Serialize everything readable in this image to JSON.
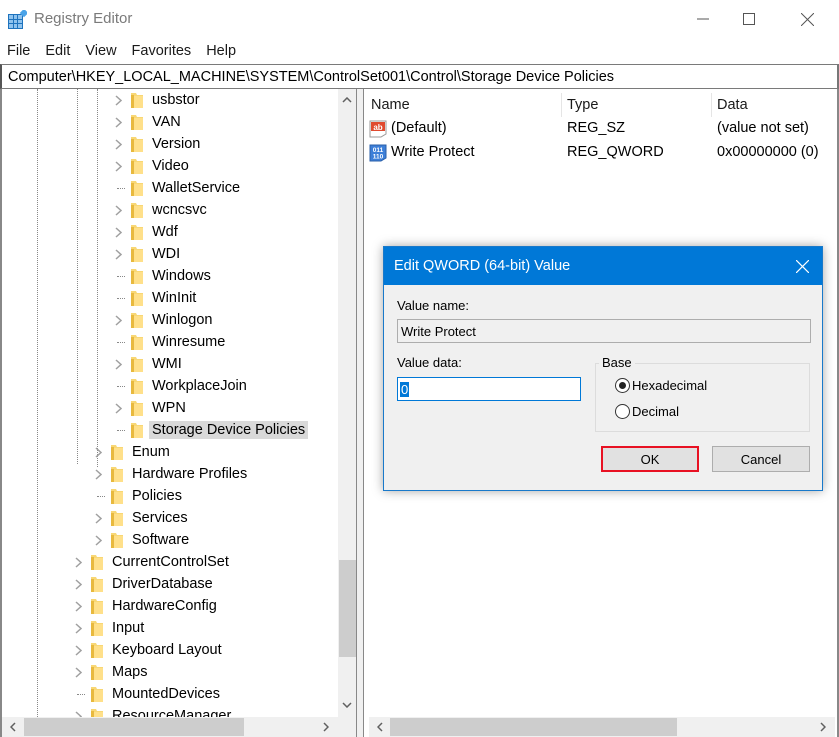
{
  "window": {
    "title": "Registry Editor",
    "icons": {
      "app": "registry-editor-icon",
      "minimize": "minimize-icon",
      "maximize": "maximize-icon",
      "close": "close-icon"
    }
  },
  "menu": [
    "File",
    "Edit",
    "View",
    "Favorites",
    "Help"
  ],
  "address": "Computer\\HKEY_LOCAL_MACHINE\\SYSTEM\\ControlSet001\\Control\\Storage Device Policies",
  "tree": {
    "items": [
      {
        "label": "usbstor",
        "expandable": true,
        "level": 3
      },
      {
        "label": "VAN",
        "expandable": true,
        "level": 3
      },
      {
        "label": "Version",
        "expandable": true,
        "level": 3
      },
      {
        "label": "Video",
        "expandable": true,
        "level": 3
      },
      {
        "label": "WalletService",
        "expandable": false,
        "level": 3
      },
      {
        "label": "wcncsvc",
        "expandable": true,
        "level": 3
      },
      {
        "label": "Wdf",
        "expandable": true,
        "level": 3
      },
      {
        "label": "WDI",
        "expandable": true,
        "level": 3
      },
      {
        "label": "Windows",
        "expandable": false,
        "level": 3
      },
      {
        "label": "WinInit",
        "expandable": false,
        "level": 3
      },
      {
        "label": "Winlogon",
        "expandable": true,
        "level": 3
      },
      {
        "label": "Winresume",
        "expandable": false,
        "level": 3
      },
      {
        "label": "WMI",
        "expandable": true,
        "level": 3
      },
      {
        "label": "WorkplaceJoin",
        "expandable": false,
        "level": 3
      },
      {
        "label": "WPN",
        "expandable": true,
        "level": 3
      },
      {
        "label": "Storage Device Policies",
        "expandable": false,
        "level": 3,
        "selected": true
      },
      {
        "label": "Enum",
        "expandable": true,
        "level": 2
      },
      {
        "label": "Hardware Profiles",
        "expandable": true,
        "level": 2
      },
      {
        "label": "Policies",
        "expandable": false,
        "level": 2
      },
      {
        "label": "Services",
        "expandable": true,
        "level": 2
      },
      {
        "label": "Software",
        "expandable": true,
        "level": 2
      },
      {
        "label": "CurrentControlSet",
        "expandable": true,
        "level": 1
      },
      {
        "label": "DriverDatabase",
        "expandable": true,
        "level": 1
      },
      {
        "label": "HardwareConfig",
        "expandable": true,
        "level": 1
      },
      {
        "label": "Input",
        "expandable": true,
        "level": 1
      },
      {
        "label": "Keyboard Layout",
        "expandable": true,
        "level": 1
      },
      {
        "label": "Maps",
        "expandable": true,
        "level": 1
      },
      {
        "label": "MountedDevices",
        "expandable": false,
        "level": 1
      },
      {
        "label": "ResourceManager",
        "expandable": true,
        "level": 1
      }
    ]
  },
  "list": {
    "columns": [
      "Name",
      "Type",
      "Data"
    ],
    "rows": [
      {
        "icon": "string-value-icon",
        "name": "(Default)",
        "type": "REG_SZ",
        "data": "(value not set)"
      },
      {
        "icon": "binary-value-icon",
        "name": "Write Protect",
        "type": "REG_QWORD",
        "data": "0x00000000 (0)"
      }
    ]
  },
  "dialog": {
    "title": "Edit QWORD (64-bit) Value",
    "value_name_label": "Value name:",
    "value_name": "Write Protect",
    "value_data_label": "Value data:",
    "value_data": "0",
    "base_label": "Base",
    "base_options": [
      {
        "label": "Hexadecimal",
        "checked": true
      },
      {
        "label": "Decimal",
        "checked": false
      }
    ],
    "ok_label": "OK",
    "cancel_label": "Cancel",
    "accent": "#0078d7",
    "highlight": "#e81123"
  }
}
